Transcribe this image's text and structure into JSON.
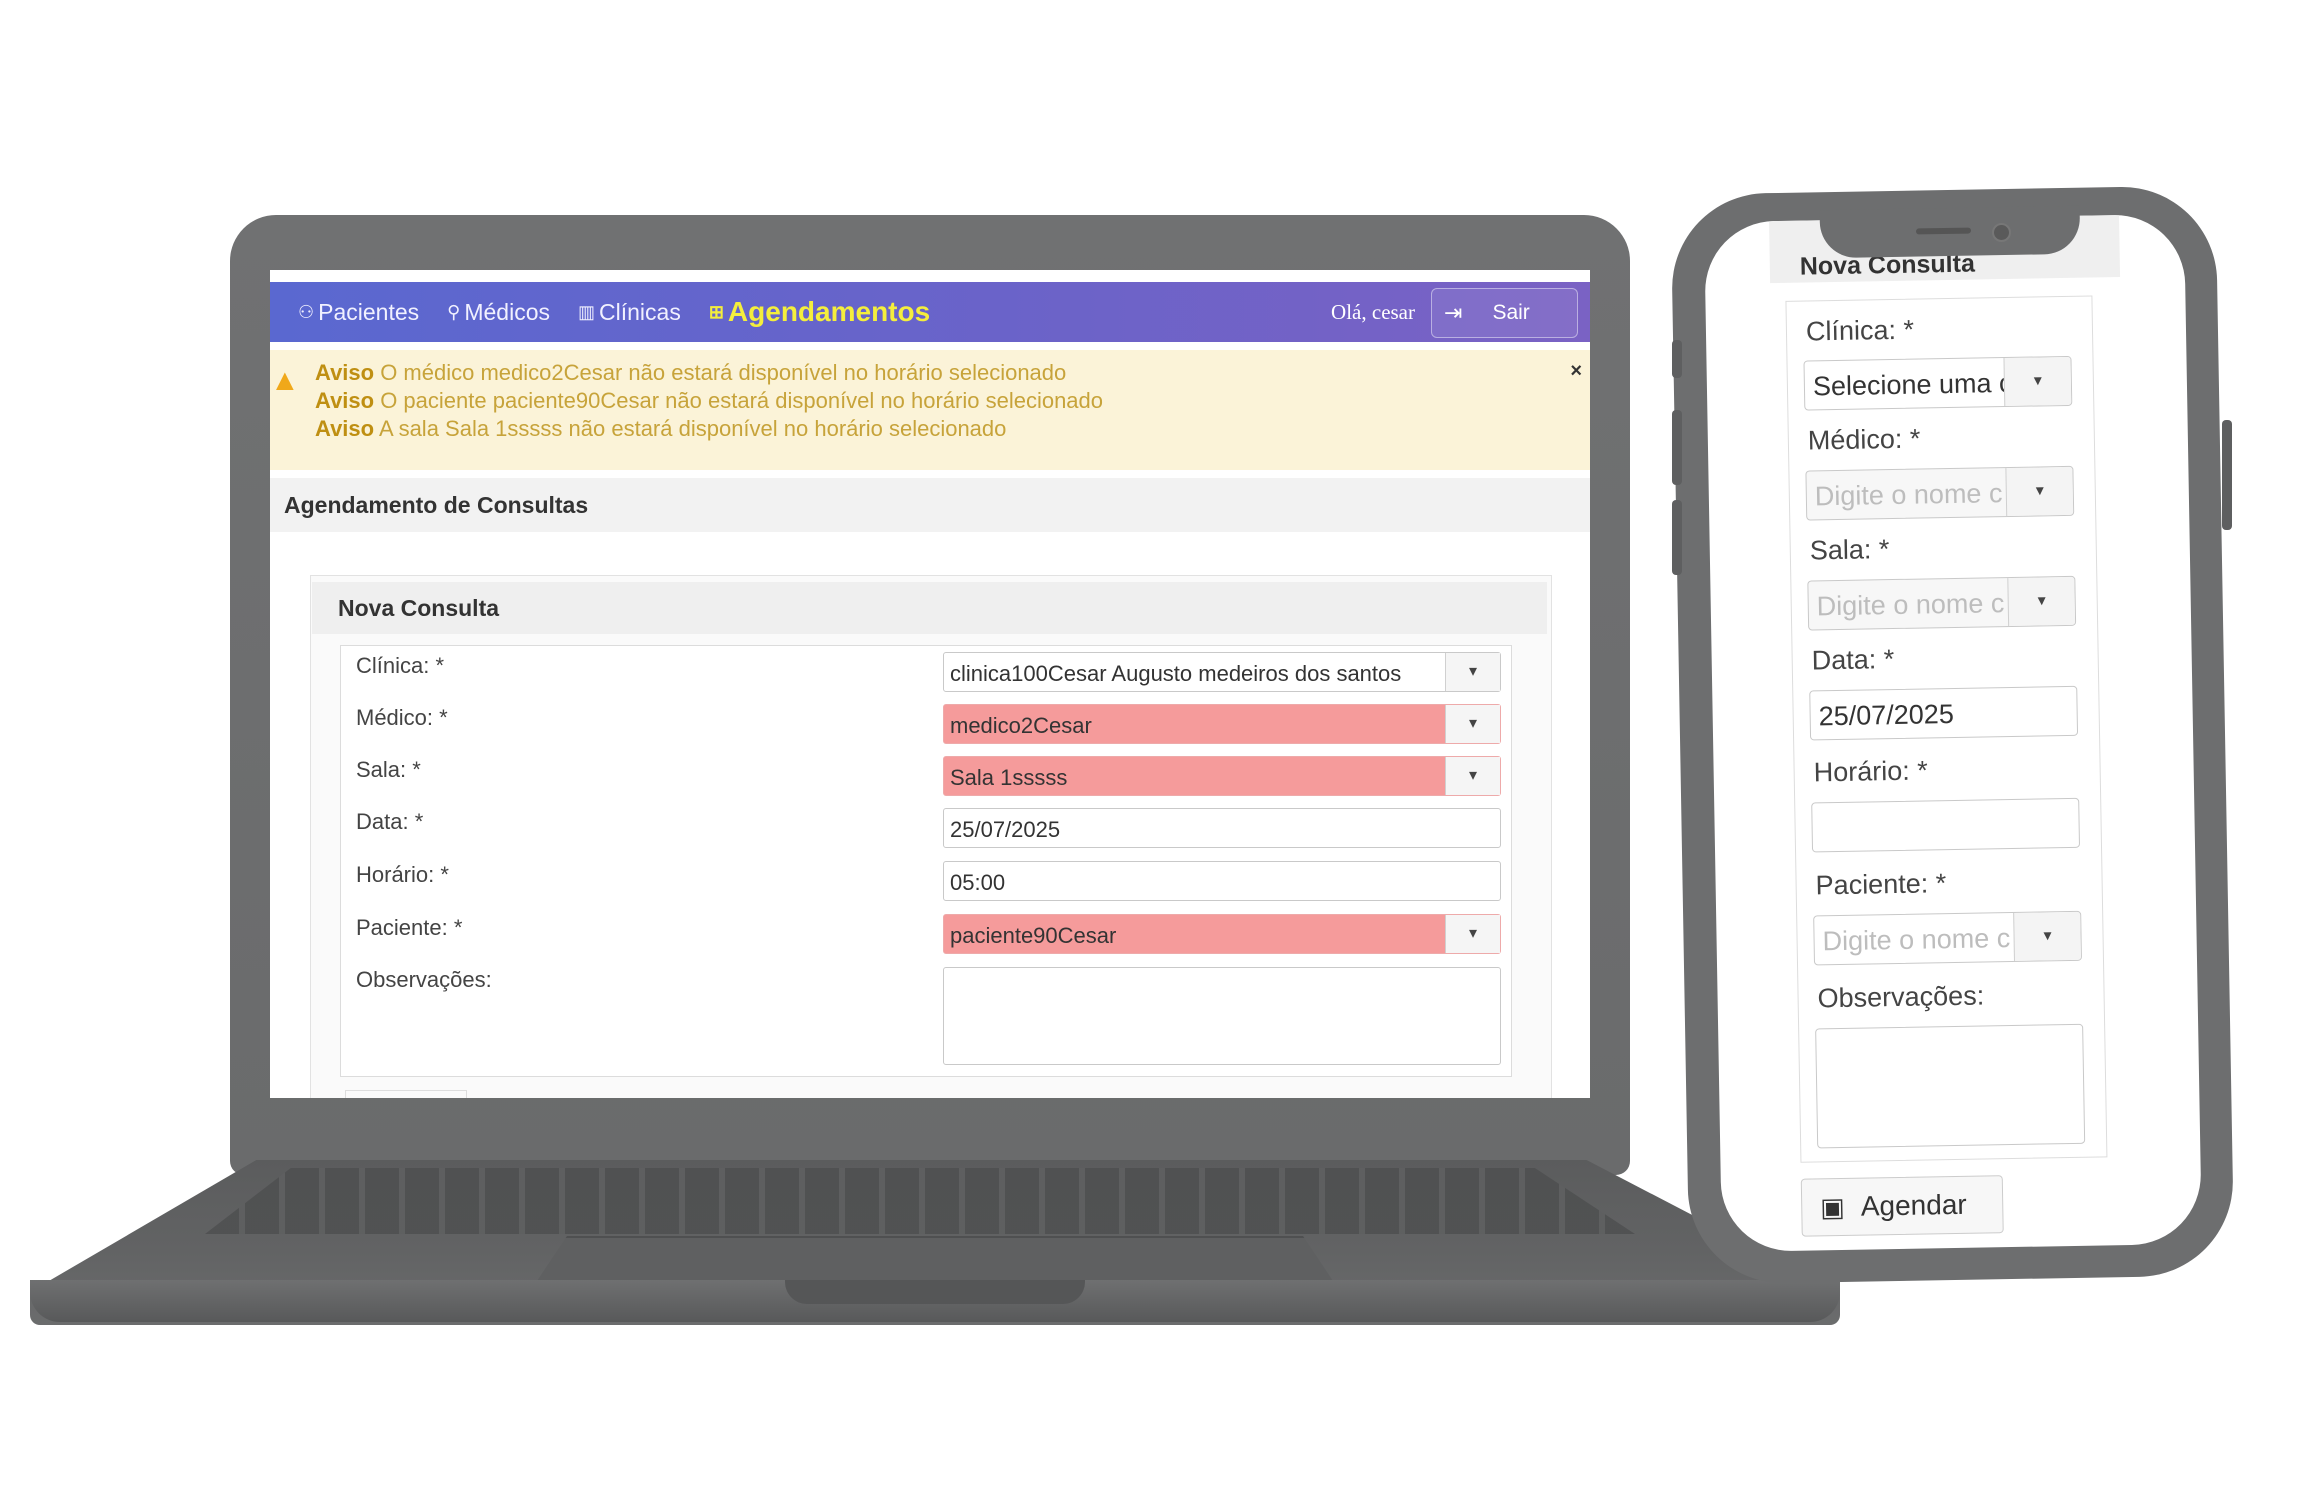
{
  "nav": {
    "items": [
      {
        "icon": "users-icon",
        "glyph": "⚇",
        "label": "Pacientes"
      },
      {
        "icon": "user-icon",
        "glyph": "⚲",
        "label": "Médicos"
      },
      {
        "icon": "building-icon",
        "glyph": "▥",
        "label": "Clínicas"
      },
      {
        "icon": "calendar-icon",
        "glyph": "⊞",
        "label": "Agendamentos"
      }
    ],
    "greeting": "Olá, cesar",
    "logout_icon": "⇥",
    "logout_label": "Sair"
  },
  "alert": {
    "icon": "warning-icon",
    "lines": [
      {
        "prefix": "Aviso",
        "text": " O médico medico2Cesar não estará disponível no horário selecionado"
      },
      {
        "prefix": "Aviso",
        "text": " O paciente paciente90Cesar não estará disponível no horário selecionado"
      },
      {
        "prefix": "Aviso",
        "text": " A sala Sala 1sssss não estará disponível no horário selecionado"
      }
    ],
    "close": "×"
  },
  "page": {
    "title": "Agendamento de Consultas",
    "form_title": "Nova Consulta"
  },
  "form": {
    "clinica_label": "Clínica: *",
    "clinica_value": "clinica100Cesar Augusto medeiros dos santos",
    "medico_label": "Médico: *",
    "medico_value": "medico2Cesar",
    "sala_label": "Sala: *",
    "sala_value": "Sala 1sssss",
    "data_label": "Data: *",
    "data_value": "25/07/2025",
    "horario_label": "Horário: *",
    "horario_value": "05:00",
    "paciente_label": "Paciente: *",
    "paciente_value": "paciente90Cesar",
    "observacoes_label": "Observações:",
    "caret": "▾"
  },
  "mobile": {
    "form_title": "Nova Consulta",
    "clinica_label": "Clínica:  *",
    "clinica_value": "Selecione uma c",
    "medico_label": "Médico:  *",
    "medico_placeholder": "Digite o nome c",
    "sala_label": "Sala:  *",
    "sala_placeholder": "Digite o nome c",
    "data_label": "Data:  *",
    "data_value": "25/07/2025",
    "horario_label": "Horário:  *",
    "paciente_label": "Paciente:  *",
    "paciente_placeholder": "Digite o nome c",
    "observacoes_label": "Observações:",
    "submit_label": "Agendar",
    "submit_icon": "▣"
  },
  "colors": {
    "navbar_start": "#5a68d0",
    "navbar_end": "#7a62c4",
    "active_nav": "#f4ee3c",
    "alert_bg": "#fbf3d8",
    "error_field": "#f59b9b"
  }
}
